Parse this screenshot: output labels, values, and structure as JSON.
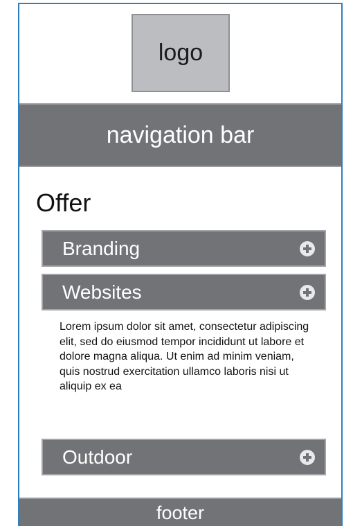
{
  "logo": {
    "label": "logo"
  },
  "navigation": {
    "label": "navigation bar"
  },
  "offer": {
    "title": "Offer",
    "items": [
      {
        "label": "Branding",
        "icon": "plus-circle-icon",
        "expanded": false
      },
      {
        "label": "Websites",
        "icon": "plus-circle-icon",
        "expanded": true,
        "body": "Lorem ipsum dolor sit amet, consectetur adipiscing elit, sed do eiusmod tempor incididunt ut labore et dolore magna aliqua. Ut enim ad minim veniam, quis nostrud exercitation ullamco laboris nisi ut aliquip ex ea"
      },
      {
        "label": "Outdoor",
        "icon": "plus-circle-icon",
        "expanded": false
      }
    ]
  },
  "footer": {
    "label": "footer"
  },
  "colors": {
    "frame_border": "#2d7fc0",
    "bar_gray": "#727376",
    "logo_gray": "#bcbdc0"
  }
}
